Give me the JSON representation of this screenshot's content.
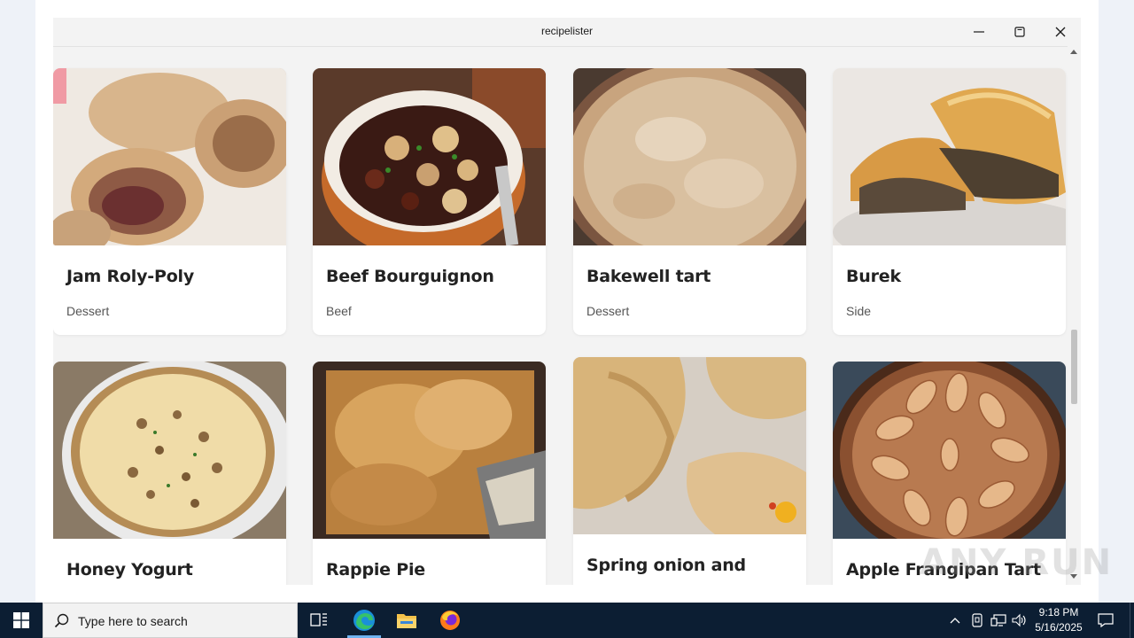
{
  "window": {
    "title": "recipelister"
  },
  "recipes": [
    {
      "name": "Jam Roly-Poly",
      "category": "Dessert"
    },
    {
      "name": "Beef Bourguignon",
      "category": "Beef"
    },
    {
      "name": "Bakewell tart",
      "category": "Dessert"
    },
    {
      "name": "Burek",
      "category": "Side"
    },
    {
      "name": "Honey Yogurt",
      "category": ""
    },
    {
      "name": "Rappie Pie",
      "category": ""
    },
    {
      "name": "Spring onion and",
      "category": ""
    },
    {
      "name": "Apple Frangipan Tart",
      "category": ""
    }
  ],
  "watermark": "ANY RUN",
  "taskbar": {
    "search_placeholder": "Type here to search",
    "time": "9:18 PM",
    "date": "5/16/2025"
  },
  "colors": {
    "taskbar": "#0c1e33",
    "card": "#ffffff",
    "window_bg": "#f3f3f3"
  }
}
